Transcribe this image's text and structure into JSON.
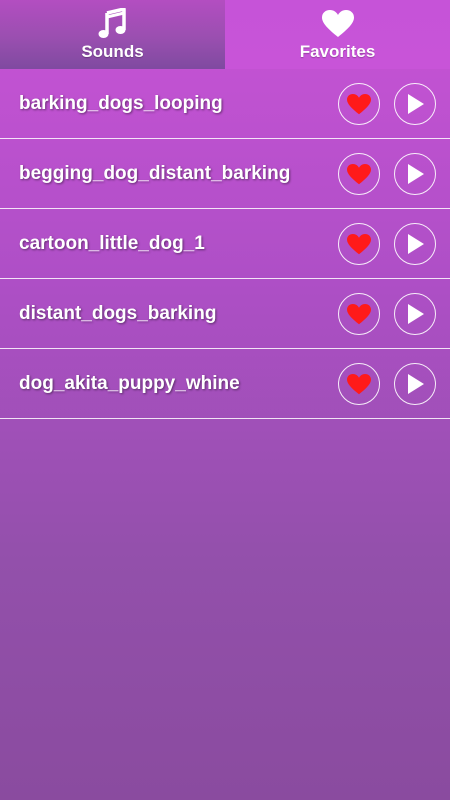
{
  "tabs": [
    {
      "label": "Sounds",
      "icon": "music-note-icon",
      "active": true
    },
    {
      "label": "Favorites",
      "icon": "heart-icon",
      "active": false
    }
  ],
  "sounds": [
    {
      "name": "barking_dogs_looping",
      "favorite": true
    },
    {
      "name": "begging_dog_distant_barking",
      "favorite": true
    },
    {
      "name": "cartoon_little_dog_1",
      "favorite": true
    },
    {
      "name": "distant_dogs_barking",
      "favorite": true
    },
    {
      "name": "dog_akita_puppy_whine",
      "favorite": true
    }
  ],
  "colors": {
    "heart": "#ff1a1a",
    "text": "#ffffff",
    "accent": "#c853d6"
  }
}
